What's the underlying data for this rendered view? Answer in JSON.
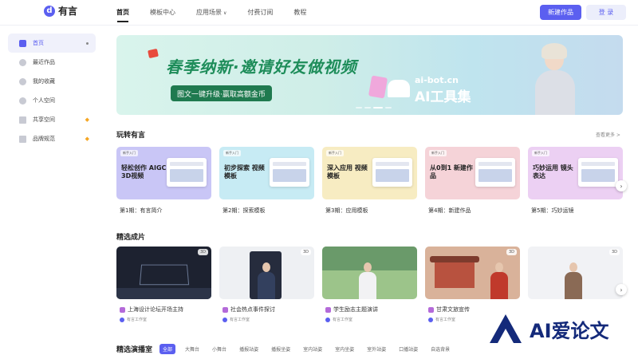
{
  "header": {
    "logo_glyph": "d",
    "logo_text": "有言",
    "nav": [
      "首页",
      "模板中心",
      "应用场景",
      "付费订阅",
      "教程"
    ],
    "scenario_arrow": "∨",
    "new_button": "新建作品",
    "login_button": "登 录"
  },
  "sidebar": {
    "items": [
      {
        "label": "首页",
        "icon": "home-icon"
      },
      {
        "label": "最近作品",
        "icon": "clock-icon"
      },
      {
        "label": "我的收藏",
        "icon": "star-icon"
      },
      {
        "label": "个人空间",
        "icon": "user-icon"
      },
      {
        "label": "共享空间",
        "icon": "grid-icon",
        "badge": "◆"
      },
      {
        "label": "品牌规范",
        "icon": "crown-icon",
        "badge": "◆"
      }
    ]
  },
  "banner": {
    "title": "春季纳新·邀请好友做视频",
    "subtitle": "图文一键升级·赢取高额金币",
    "brand_line1": "ai-bot.cn",
    "brand_line2": "AI工具集"
  },
  "section_play": {
    "title": "玩转有言",
    "more": "查看更多 >",
    "cards": [
      {
        "badge": "新手入门",
        "thumb_title": "轻松创作 AIGC 3D视频",
        "label": "第1期：有言简介",
        "bg": "#c9c6f6"
      },
      {
        "badge": "新手入门",
        "thumb_title": "初步探索 视频模板",
        "label": "第2期：探索模板",
        "bg": "#c7ebf4"
      },
      {
        "badge": "新手入门",
        "thumb_title": "深入应用 视频模板",
        "label": "第3期：应用模板",
        "bg": "#f7ecc2"
      },
      {
        "badge": "新手入门",
        "thumb_title": "从0到1 新建作品",
        "label": "第4期：新建作品",
        "bg": "#f5d3d8"
      },
      {
        "badge": "新手入门",
        "thumb_title": "巧妙运用 镜头表达",
        "label": "第5期：巧妙运镜",
        "bg": "#ecd0f3"
      }
    ]
  },
  "section_featured": {
    "title": "精选成片",
    "badge_3d": "3D",
    "cards": [
      {
        "label": "上海设计论坛开场主持",
        "author": "有言工作室",
        "bg": "#1d2230"
      },
      {
        "label": "社会热点事件探讨",
        "author": "有言工作室",
        "bg": "#eef0f3"
      },
      {
        "label": "学生励志主题演讲",
        "author": "有言工作室",
        "bg": "#9cc48a"
      },
      {
        "label": "甘肃文旅宣传",
        "author": "有言工作室",
        "bg": "#d9b29a"
      },
      {
        "label": "",
        "author": "",
        "bg": "#f1f2f5"
      }
    ]
  },
  "filters": {
    "title": "精选演播室",
    "items": [
      "全部",
      "大舞台",
      "小舞台",
      "播报站姿",
      "播报坐姿",
      "室内站姿",
      "室内坐姿",
      "室外站姿",
      "口播站姿",
      "自选背景"
    ]
  },
  "watermark": {
    "text": "AI爱论文"
  },
  "colors": {
    "accent": "#5b5ff0",
    "banner_green": "#1e8d5a",
    "watermark": "#142a7a"
  },
  "arrow": "›"
}
